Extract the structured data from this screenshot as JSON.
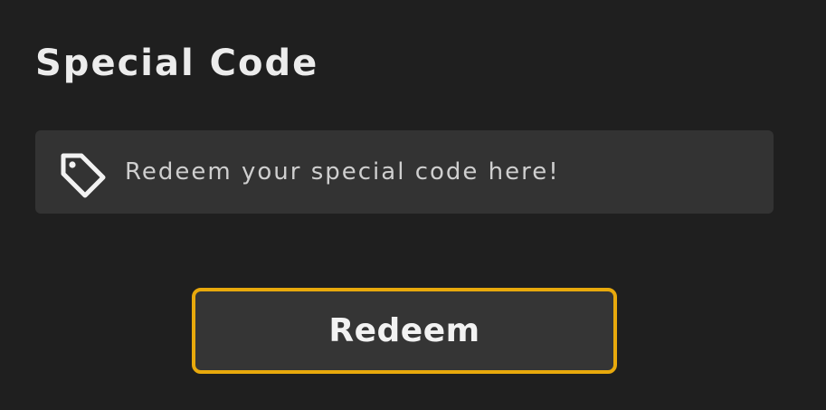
{
  "page": {
    "title": "Special Code"
  },
  "code_field": {
    "icon": "tag-icon",
    "placeholder": "Redeem your special code here!",
    "value": ""
  },
  "redeem_button": {
    "label": "Redeem"
  },
  "colors": {
    "background": "#1f1f1f",
    "field_background": "#333333",
    "button_background": "#353535",
    "button_border_accent": "#e8a90c",
    "text_primary": "#ececec",
    "text_placeholder": "#cfcfcf"
  }
}
